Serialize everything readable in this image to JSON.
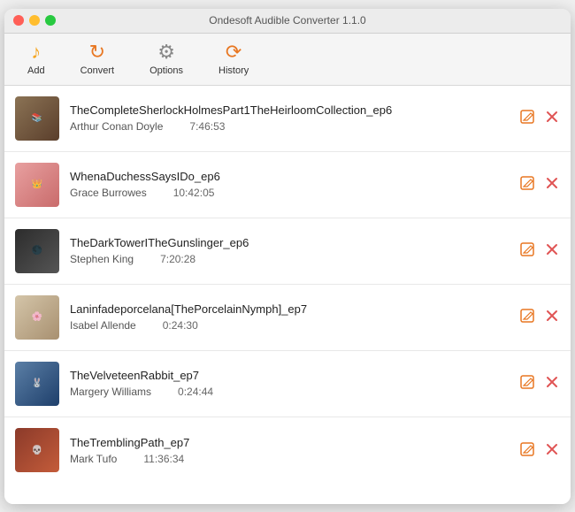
{
  "window": {
    "title": "Ondesoft Audible Converter 1.1.0"
  },
  "toolbar": {
    "add_label": "Add",
    "convert_label": "Convert",
    "options_label": "Options",
    "history_label": "History"
  },
  "books": [
    {
      "id": 1,
      "title": "TheCompleteSherlockHolmesPart1TheHeirloomCollection_ep6",
      "author": "Arthur Conan Doyle",
      "duration": "7:46:53",
      "art_class": "art-1",
      "art_text": "📚"
    },
    {
      "id": 2,
      "title": "WhenaDuchessSaysIDo_ep6",
      "author": "Grace Burrowes",
      "duration": "10:42:05",
      "art_class": "art-2",
      "art_text": "👑"
    },
    {
      "id": 3,
      "title": "TheDarkTowerITheGunslinger_ep6",
      "author": "Stephen King",
      "duration": "7:20:28",
      "art_class": "art-3",
      "art_text": "🌑"
    },
    {
      "id": 4,
      "title": "Laninfadeporcelana[ThePorcelainNymph]_ep7",
      "author": "Isabel Allende",
      "duration": "0:24:30",
      "art_class": "art-4",
      "art_text": "🌸"
    },
    {
      "id": 5,
      "title": "TheVelveteenRabbit_ep7",
      "author": "Margery Williams",
      "duration": "0:24:44",
      "art_class": "art-5",
      "art_text": "🐰"
    },
    {
      "id": 6,
      "title": "TheTremblingPath_ep7",
      "author": "Mark Tufo",
      "duration": "11:36:34",
      "art_class": "art-6",
      "art_text": "💀"
    }
  ],
  "actions": {
    "edit_icon": "⬚",
    "delete_icon": "✕"
  }
}
